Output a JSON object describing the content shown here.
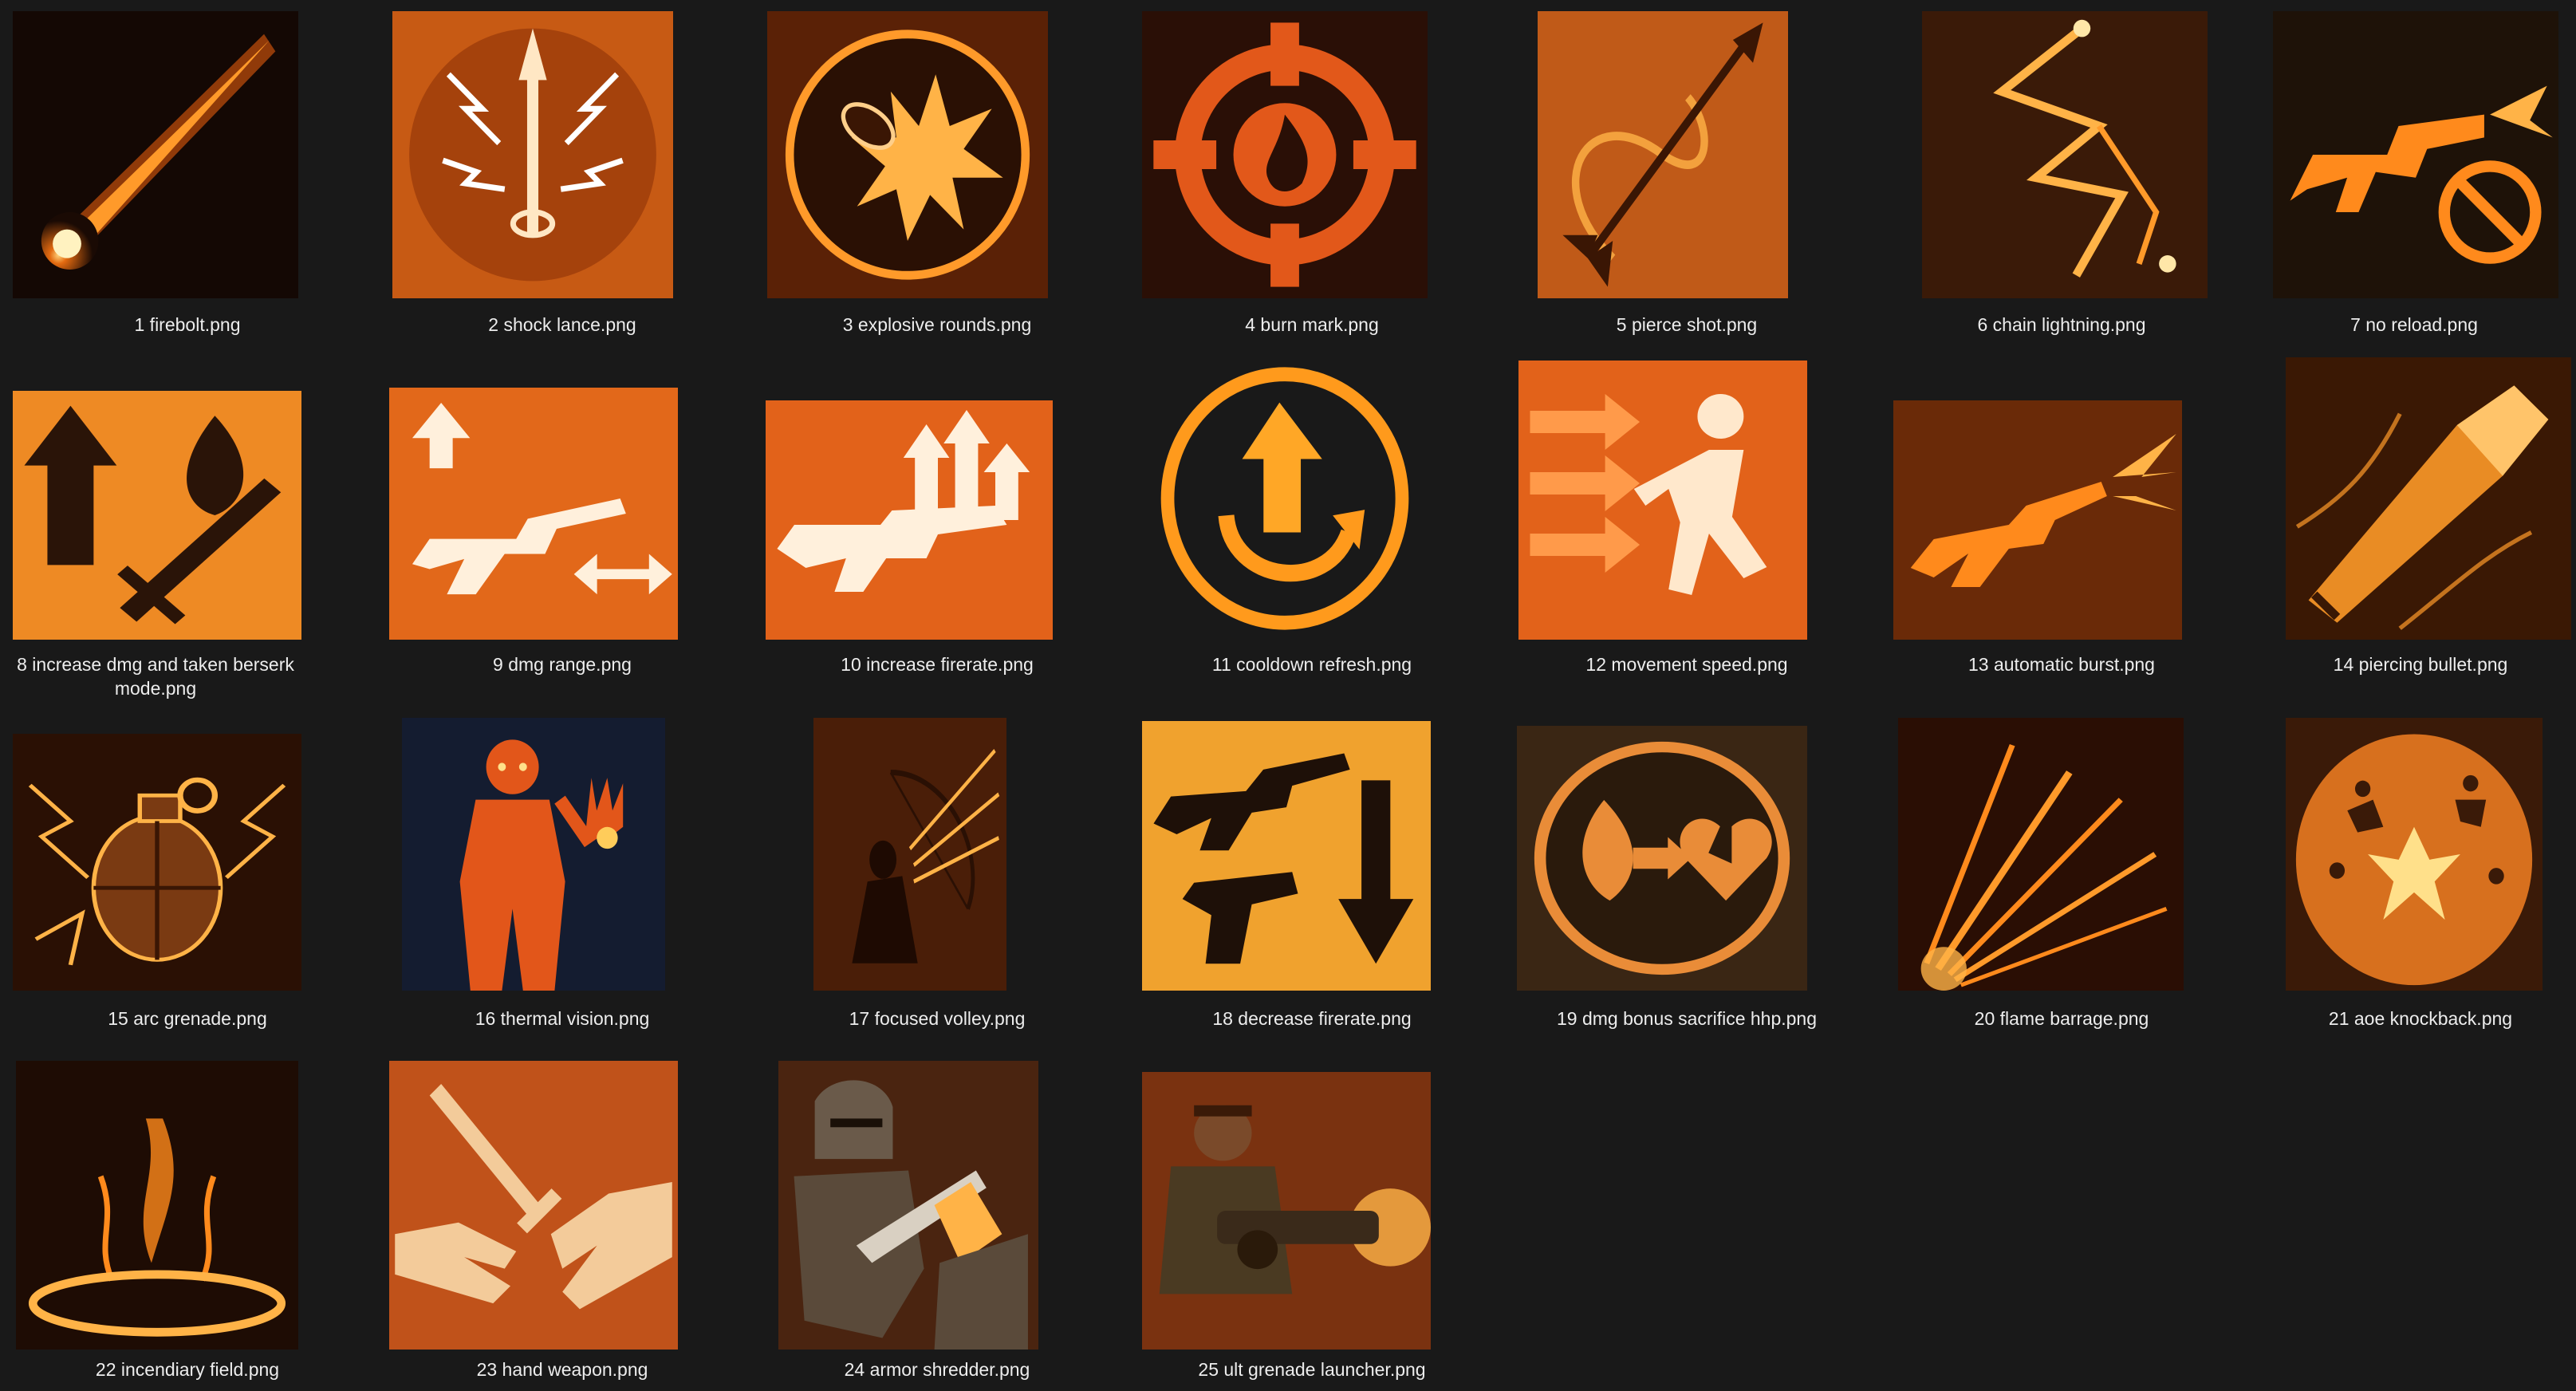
{
  "files": [
    {
      "name": "1 firebolt.png",
      "icon": "firebolt-icon"
    },
    {
      "name": "2 shock lance.png",
      "icon": "shock-lance-icon"
    },
    {
      "name": "3 explosive rounds.png",
      "icon": "explosive-rounds-icon"
    },
    {
      "name": "4 burn mark.png",
      "icon": "burn-mark-icon"
    },
    {
      "name": "5 pierce shot.png",
      "icon": "pierce-shot-icon"
    },
    {
      "name": "6 chain lightning.png",
      "icon": "chain-lightning-icon"
    },
    {
      "name": "7 no reload.png",
      "icon": "no-reload-icon"
    },
    {
      "name": "8 increase dmg and taken berserk mode.png",
      "icon": "berserk-mode-icon"
    },
    {
      "name": "9  dmg range.png",
      "icon": "dmg-range-icon"
    },
    {
      "name": "10 increase firerate.png",
      "icon": "increase-firerate-icon"
    },
    {
      "name": "11 cooldown refresh.png",
      "icon": "cooldown-refresh-icon"
    },
    {
      "name": "12 movement speed.png",
      "icon": "movement-speed-icon"
    },
    {
      "name": "13 automatic burst.png",
      "icon": "automatic-burst-icon"
    },
    {
      "name": "14 piercing bullet.png",
      "icon": "piercing-bullet-icon"
    },
    {
      "name": "15 arc grenade.png",
      "icon": "arc-grenade-icon"
    },
    {
      "name": "16 thermal vision.png",
      "icon": "thermal-vision-icon"
    },
    {
      "name": "17 focused volley.png",
      "icon": "focused-volley-icon"
    },
    {
      "name": "18 decrease firerate.png",
      "icon": "decrease-firerate-icon"
    },
    {
      "name": "19 dmg bonus sacrifice hhp.png",
      "icon": "sacrifice-hp-icon"
    },
    {
      "name": "20 flame barrage.png",
      "icon": "flame-barrage-icon"
    },
    {
      "name": "21 aoe knockback.png",
      "icon": "aoe-knockback-icon"
    },
    {
      "name": "22 incendiary field.png",
      "icon": "incendiary-field-icon"
    },
    {
      "name": "23 hand weapon.png",
      "icon": "hand-weapon-icon"
    },
    {
      "name": "24 armor shredder.png",
      "icon": "armor-shredder-icon"
    },
    {
      "name": "25 ult grenade launcher.png",
      "icon": "grenade-launcher-icon"
    }
  ],
  "colors": {
    "background": "#191919",
    "caption": "#ededed",
    "accent": "#ff8a1c"
  }
}
